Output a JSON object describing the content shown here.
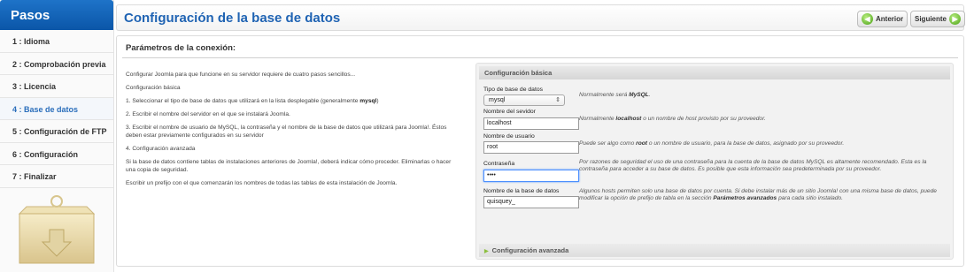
{
  "sidebar": {
    "title": "Pasos",
    "steps": [
      {
        "label": "1 : Idioma"
      },
      {
        "label": "2 : Comprobación previa"
      },
      {
        "label": "3 : Licencia"
      },
      {
        "label": "4 : Base de datos"
      },
      {
        "label": "5 : Configuración de FTP"
      },
      {
        "label": "6 : Configuración"
      },
      {
        "label": "7 : Finalizar"
      }
    ],
    "active_step": 3
  },
  "header": {
    "title": "Configuración de la base de datos",
    "prev_label": "Anterior",
    "next_label": "Siguiente"
  },
  "main": {
    "title": "Parámetros de la conexión:",
    "intro": {
      "p1": "Configurar Joomla para que funcione en su servidor requiere de cuatro pasos sencillos...",
      "p2": "Configuración básica",
      "p3a": "1. Seleccionar el tipo de base de datos que utilizará en la lista desplegable (generalmente ",
      "p3b": "mysql",
      "p3c": ")",
      "p4": "2. Escribir el nombre del servidor en el que se instalará Joomla.",
      "p5": "3. Escribir el nombre de usuario de MySQL, la contraseña y el nombre de la base de datos que utilizará para Joomla!. Éstos deben estar previamente configurados en su servidor",
      "p6": "4. Configuración avanzada",
      "p7": "Si la base de datos contiene tablas de instalaciones anteriores de Joomla!, deberá indicar cómo proceder. Eliminarlas o hacer una copia de seguridad.",
      "p8": "Escribir un prefijo con el que comenzarán los nombres de todas las tablas de esta instalación de Joomla."
    }
  },
  "config": {
    "basic_title": "Configuración básica",
    "advanced_title": "Configuración avanzada",
    "db_type": {
      "label": "Tipo de base de datos",
      "value": "mysql",
      "hint_a": "Normalmente será ",
      "hint_b": "MySQL",
      "hint_c": "."
    },
    "host": {
      "label": "Nombre del sevidor",
      "value": "localhost",
      "hint_a": "Normalmente ",
      "hint_b": "localhost",
      "hint_c": " o un nombre de host provisto por su proveedor."
    },
    "user": {
      "label": "Nombre de usuario",
      "value": "root",
      "hint_a": "Puede ser algo como ",
      "hint_b": "root",
      "hint_c": " o un nombre de usuario, para la base de datos, asignado por su proveedor."
    },
    "password": {
      "label": "Contraseña",
      "value": "••••",
      "hint": "Por razones de seguridad el uso de una contraseña para la cuenta de la base de datos MySQL es altamente recomendado. Esta es la contraseña para acceder a su base de datos. Es posible que esta información sea predeterminada por su proveedor."
    },
    "dbname": {
      "label": "Nombre de la base de datos",
      "value": "quisquey_",
      "hint_a": "Algunos hosts permiten solo una base de datos por cuenta. Si debe instalar más de un sitio Joomla! con una misma base de datos, puede modificar la opción de prefijo de tabla en la sección ",
      "hint_b": "Parámetros avanzados",
      "hint_c": " para cada sitio instalado."
    }
  },
  "colors": {
    "accent": "#1f63b3",
    "sidebar_header": "#0b56a8",
    "next_button_icon": "#4aa115"
  }
}
